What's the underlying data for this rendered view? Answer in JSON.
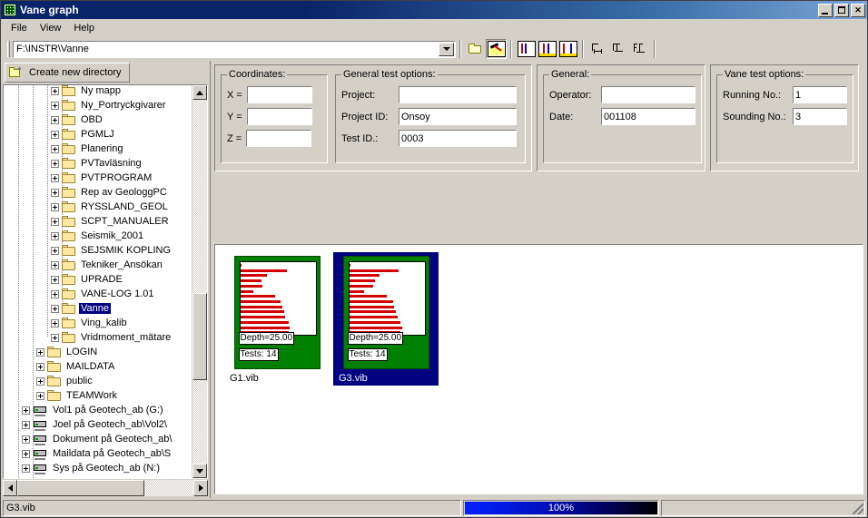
{
  "window": {
    "title": "Vane graph",
    "icon": "graph-grid-icon",
    "minimize_label": "Minimize",
    "maximize_label": "Maximize",
    "close_label": "Close"
  },
  "menu": {
    "items": [
      {
        "label": "File"
      },
      {
        "label": "View"
      },
      {
        "label": "Help"
      }
    ]
  },
  "toolbar": {
    "path_value": "F:\\INSTR\\Vanne",
    "buttons": [
      {
        "name": "open-folder-button",
        "icon": "folder-open-icon",
        "tooltip": "Open"
      },
      {
        "name": "tool-button",
        "icon": "hammer-icon",
        "tooltip": "Tool"
      },
      {
        "name": "graph-view-1-button",
        "icon": "graph-plain-icon",
        "tooltip": "Graph view 1"
      },
      {
        "name": "graph-view-2-button",
        "icon": "graph-yellow-icon",
        "tooltip": "Graph view 2"
      },
      {
        "name": "graph-view-3-button",
        "icon": "graph-dual-icon",
        "tooltip": "Graph view 3"
      },
      {
        "name": "layout-1-button",
        "icon": "align-left-icon",
        "tooltip": "Layout 1"
      },
      {
        "name": "layout-2-button",
        "icon": "align-center-icon",
        "tooltip": "Layout 2"
      },
      {
        "name": "layout-3-button",
        "icon": "align-right-icon",
        "tooltip": "Layout 3"
      }
    ]
  },
  "sidebar": {
    "create_new_directory_label": "Create new directory",
    "create_new_directory_icon": "new-folder-icon",
    "tree": [
      {
        "label": "Ny mapp",
        "type": "folder",
        "indent": 4,
        "selected": false
      },
      {
        "label": "Ny_Portryckgivarer",
        "type": "folder",
        "indent": 4,
        "selected": false
      },
      {
        "label": "OBD",
        "type": "folder",
        "indent": 4,
        "selected": false
      },
      {
        "label": "PGMLJ",
        "type": "folder",
        "indent": 4,
        "selected": false
      },
      {
        "label": "Planering",
        "type": "folder",
        "indent": 4,
        "selected": false
      },
      {
        "label": "PVTavläsning",
        "type": "folder",
        "indent": 4,
        "selected": false
      },
      {
        "label": "PVTPROGRAM",
        "type": "folder",
        "indent": 4,
        "selected": false
      },
      {
        "label": "Rep av GeologgPC",
        "type": "folder",
        "indent": 4,
        "selected": false
      },
      {
        "label": "RYSSLAND_GEOL",
        "type": "folder",
        "indent": 4,
        "selected": false
      },
      {
        "label": "SCPT_MANUALER",
        "type": "folder",
        "indent": 4,
        "selected": false
      },
      {
        "label": "Seismik_2001",
        "type": "folder",
        "indent": 4,
        "selected": false
      },
      {
        "label": "SEJSMIK KOPLING",
        "type": "folder",
        "indent": 4,
        "selected": false
      },
      {
        "label": "Tekniker_Ansökan",
        "type": "folder",
        "indent": 4,
        "selected": false
      },
      {
        "label": "UPRADE",
        "type": "folder",
        "indent": 4,
        "selected": false
      },
      {
        "label": "VANE-LOG 1.01",
        "type": "folder",
        "indent": 4,
        "selected": false
      },
      {
        "label": "Vanne",
        "type": "folder",
        "indent": 4,
        "selected": true
      },
      {
        "label": "Ving_kalib",
        "type": "folder",
        "indent": 4,
        "selected": false
      },
      {
        "label": "Vridmoment_mätare",
        "type": "folder",
        "indent": 4,
        "selected": false
      },
      {
        "label": "LOGIN",
        "type": "folder",
        "indent": 3,
        "selected": false
      },
      {
        "label": "MAILDATA",
        "type": "folder",
        "indent": 3,
        "selected": false
      },
      {
        "label": "public",
        "type": "folder",
        "indent": 3,
        "selected": false
      },
      {
        "label": "TEAMWork",
        "type": "folder",
        "indent": 3,
        "selected": false
      },
      {
        "label": "Vol1 på Geotech_ab (G:)",
        "type": "drive",
        "indent": 2,
        "selected": false
      },
      {
        "label": "Joel på Geotech_ab\\Vol2\\",
        "type": "drive",
        "indent": 2,
        "selected": false
      },
      {
        "label": "Dokument på Geotech_ab\\",
        "type": "drive",
        "indent": 2,
        "selected": false
      },
      {
        "label": "Maildata på Geotech_ab\\S",
        "type": "drive",
        "indent": 2,
        "selected": false
      },
      {
        "label": "Sys på Geotech_ab (N:)",
        "type": "drive",
        "indent": 2,
        "selected": false
      }
    ]
  },
  "forms": {
    "coordinates": {
      "legend": "Coordinates:",
      "fields": [
        {
          "label": "X =",
          "value": ""
        },
        {
          "label": "Y =",
          "value": ""
        },
        {
          "label": "Z =",
          "value": ""
        }
      ]
    },
    "general_test_options": {
      "legend": "General test options:",
      "fields": [
        {
          "label": "Project:",
          "value": ""
        },
        {
          "label": "Project ID:",
          "value": "Onsoy"
        },
        {
          "label": "Test ID.:",
          "value": "0003"
        }
      ]
    },
    "general": {
      "legend": "General:",
      "fields": [
        {
          "label": "Operator:",
          "value": ""
        },
        {
          "label": "Date:",
          "value": "001108"
        }
      ]
    },
    "vane_test_options": {
      "legend": "Vane test options:",
      "fields": [
        {
          "label": "Running No.:",
          "value": "1"
        },
        {
          "label": "Sounding No.:",
          "value": "3"
        }
      ]
    }
  },
  "thumbnails": [
    {
      "name": "G1.vib",
      "selected": false,
      "depth_label": "Depth=25.00",
      "tests_label": "Tests: 14",
      "chart_data": {
        "type": "bar",
        "title": "G1.vib vane profile",
        "orientation": "horizontal",
        "categories": [
          "1",
          "2",
          "3",
          "4",
          "5",
          "6",
          "7",
          "8",
          "9",
          "10",
          "11",
          "12",
          "13",
          "14"
        ],
        "values": [
          0,
          62,
          36,
          28,
          30,
          18,
          46,
          54,
          56,
          58,
          60,
          64,
          66,
          64
        ],
        "xlabel": "",
        "ylabel": "Depth",
        "xlim": [
          0,
          100
        ],
        "series_color": "#d40000"
      }
    },
    {
      "name": "G3.vib",
      "selected": true,
      "depth_label": "Depth=25.00",
      "tests_label": "Tests: 14",
      "chart_data": {
        "type": "bar",
        "title": "G3.vib vane profile",
        "orientation": "horizontal",
        "categories": [
          "1",
          "2",
          "3",
          "4",
          "5",
          "6",
          "7",
          "8",
          "9",
          "10",
          "11",
          "12",
          "13",
          "14"
        ],
        "values": [
          0,
          66,
          40,
          34,
          32,
          20,
          50,
          58,
          60,
          62,
          64,
          68,
          70,
          68
        ],
        "xlabel": "",
        "ylabel": "Depth",
        "xlim": [
          0,
          100
        ],
        "series_color": "#d40000"
      }
    }
  ],
  "statusbar": {
    "file_label": "G3.vib",
    "progress_text": "100%",
    "progress_percent": 100,
    "right_label": ""
  },
  "colors": {
    "title_active": "#0a246a",
    "face": "#d4d0c8",
    "selection": "#000080",
    "thumb_green": "#008000",
    "bar_red": "#d40000",
    "progress_blue": "#0020ff"
  }
}
